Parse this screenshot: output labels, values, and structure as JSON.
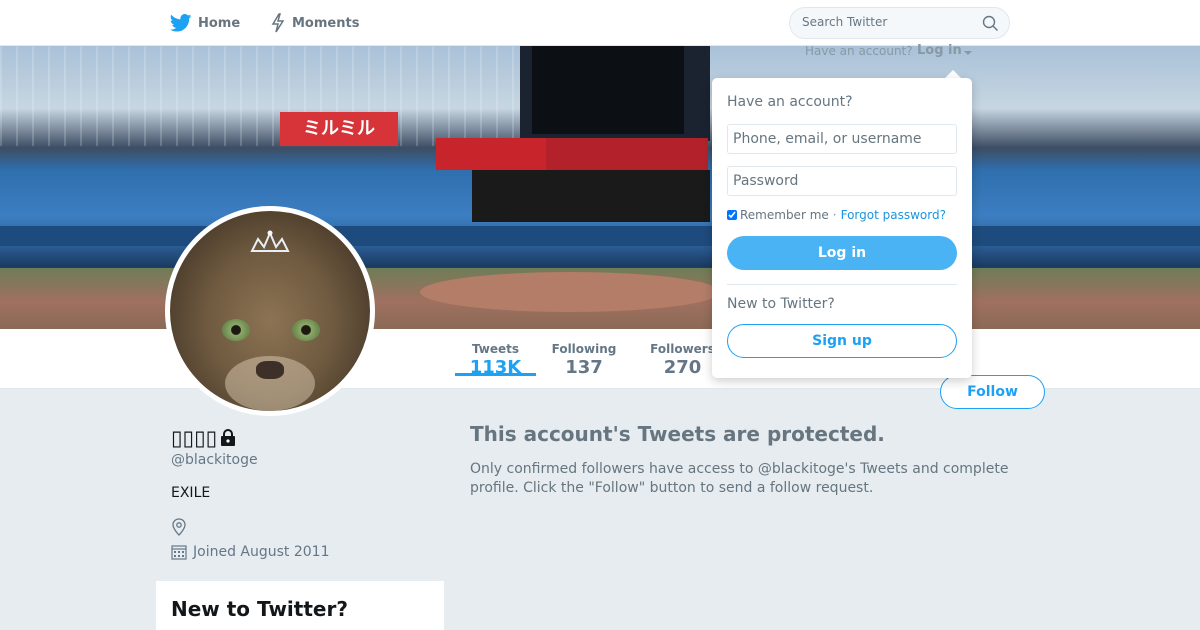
{
  "nav": {
    "home_label": "Home",
    "moments_label": "Moments",
    "search_placeholder": "Search Twitter",
    "brand_color": "#1da1f2"
  },
  "login_prompt": {
    "have_account": "Have an account?",
    "login_link": "Log in"
  },
  "banner": {
    "sign_text": "ミルミル"
  },
  "profile": {
    "name": "▯▯▯▯",
    "handle": "@blackitoge",
    "bio": "EXILE",
    "location": "",
    "joined": "Joined August 2011",
    "stats": {
      "tweets_label": "Tweets",
      "tweets_value": "113K",
      "following_label": "Following",
      "following_value": "137",
      "followers_label": "Followers",
      "followers_value": "270"
    },
    "follow_label": "Follow"
  },
  "main": {
    "protected_title": "This account's Tweets are protected.",
    "protected_text": "Only confirmed followers have access to @blackitoge's Tweets and complete profile. Click the \"Follow\" button to send a follow request."
  },
  "sidebar": {
    "new_to_twitter": "New to Twitter?"
  },
  "login_dropdown": {
    "heading": "Have an account?",
    "username_placeholder": "Phone, email, or username",
    "password_placeholder": "Password",
    "remember_label": "Remember me",
    "separator": "·",
    "forgot_label": "Forgot password?",
    "login_button": "Log in",
    "new_to_twitter": "New to Twitter?",
    "signup_button": "Sign up"
  }
}
